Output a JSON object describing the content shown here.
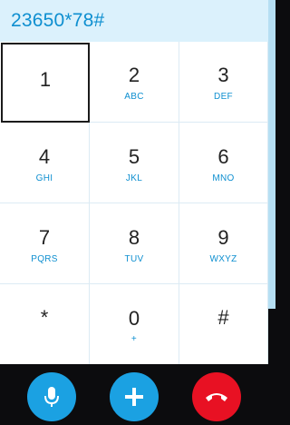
{
  "dialer": {
    "number": "23650*78#"
  },
  "keys": [
    {
      "digit": "1",
      "letters": ""
    },
    {
      "digit": "2",
      "letters": "ABC"
    },
    {
      "digit": "3",
      "letters": "DEF"
    },
    {
      "digit": "4",
      "letters": "GHI"
    },
    {
      "digit": "5",
      "letters": "JKL"
    },
    {
      "digit": "6",
      "letters": "MNO"
    },
    {
      "digit": "7",
      "letters": "PQRS"
    },
    {
      "digit": "8",
      "letters": "TUV"
    },
    {
      "digit": "9",
      "letters": "WXYZ"
    },
    {
      "digit": "*",
      "letters": ""
    },
    {
      "digit": "0",
      "letters": "+"
    },
    {
      "digit": "#",
      "letters": ""
    }
  ],
  "actions": {
    "mic_icon": "microphone-icon",
    "add_icon": "plus-icon",
    "hangup_icon": "hang-up-icon",
    "blue": "#1ba1e2",
    "red": "#e81123"
  }
}
